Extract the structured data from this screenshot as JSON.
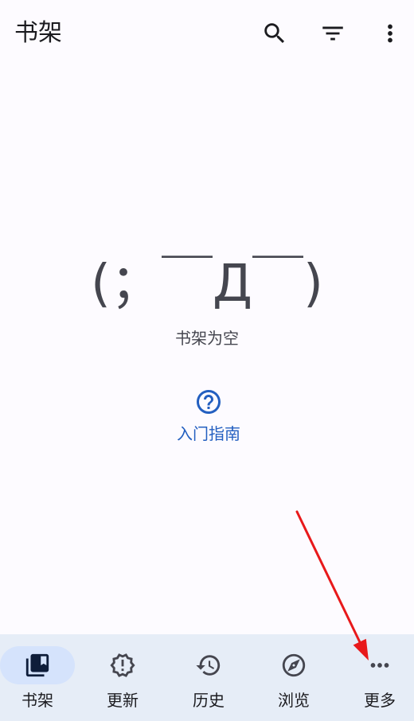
{
  "app_bar": {
    "title": "书架",
    "actions": [
      {
        "icon": "search-icon"
      },
      {
        "icon": "filter-icon"
      },
      {
        "icon": "more-vert-icon"
      }
    ]
  },
  "empty_state": {
    "face": "(；￣Д￣)",
    "message": "书架为空",
    "help": {
      "label": "入门指南",
      "icon": "help-circle-icon"
    }
  },
  "bottom_nav": {
    "items": [
      {
        "label": "书架",
        "icon": "library-icon",
        "active": true
      },
      {
        "label": "更新",
        "icon": "updates-icon",
        "active": false
      },
      {
        "label": "历史",
        "icon": "history-icon",
        "active": false
      },
      {
        "label": "浏览",
        "icon": "explore-icon",
        "active": false
      },
      {
        "label": "更多",
        "icon": "more-horiz-icon",
        "active": false
      }
    ]
  },
  "colors": {
    "background": "#FDFBFF",
    "nav_background": "#E6EDF7",
    "indicator": "#D5E3FC",
    "text": "#1B1B1F",
    "muted_text": "#45464F",
    "primary": "#235FC0",
    "active_icon": "#0E1D3A",
    "annotation": "#E8191B"
  }
}
